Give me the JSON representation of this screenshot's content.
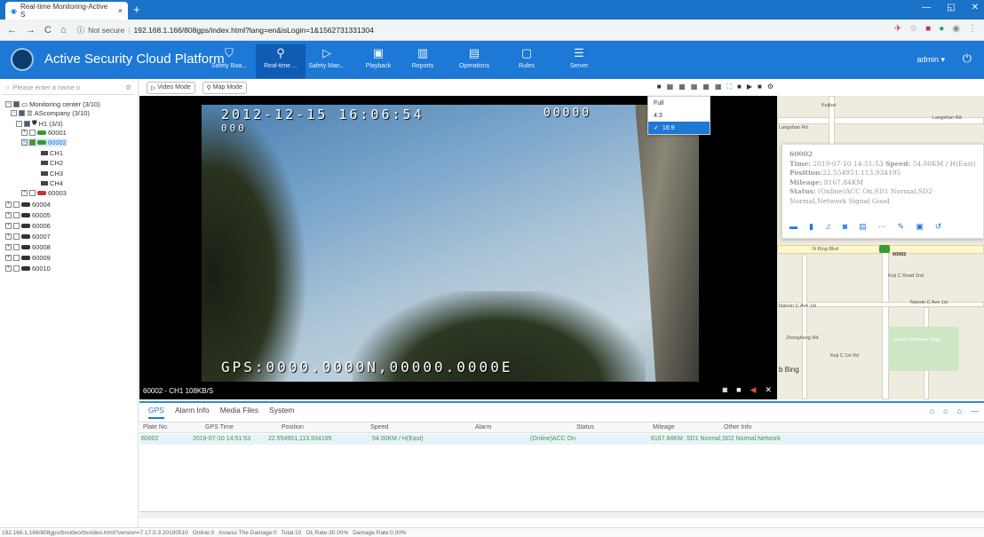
{
  "browser": {
    "tab_title": "Real-time Monitoring-Active S",
    "security_label": "Not secure",
    "url": "192.168.1.166/808gps/index.html?lang=en&isLogin=1&1562731331304"
  },
  "app": {
    "title": "Active Security Cloud Platform",
    "nav": [
      {
        "label": "Safety Boa...",
        "icon": "shield-icon"
      },
      {
        "label": "Real-time ...",
        "icon": "location-pin-icon"
      },
      {
        "label": "Safety Man...",
        "icon": "play-shield-icon"
      },
      {
        "label": "Playback",
        "icon": "playback-icon"
      },
      {
        "label": "Reports",
        "icon": "bar-chart-icon"
      },
      {
        "label": "Operations",
        "icon": "operations-icon"
      },
      {
        "label": "Rules",
        "icon": "rules-icon"
      },
      {
        "label": "Server",
        "icon": "server-icon"
      }
    ],
    "user": "admin"
  },
  "sidebar": {
    "search_placeholder": "Please enter a name o",
    "tree": [
      {
        "label": "Monitoring center (3/10)"
      },
      {
        "label": "AScompany (3/10)"
      },
      {
        "label": "H1 (3/3)"
      },
      {
        "label": "60001"
      },
      {
        "label": "60002"
      },
      {
        "label": "CH1"
      },
      {
        "label": "CH2"
      },
      {
        "label": "CH3"
      },
      {
        "label": "CH4"
      },
      {
        "label": "60003"
      },
      {
        "label": "60004"
      },
      {
        "label": "60005"
      },
      {
        "label": "60006"
      },
      {
        "label": "60007"
      },
      {
        "label": "60008"
      },
      {
        "label": "60009"
      },
      {
        "label": "60010"
      }
    ]
  },
  "modes": {
    "video": "Video Mode",
    "map": "Map Mode"
  },
  "ratio_menu": {
    "options": [
      "Full",
      "4:3",
      "16:9"
    ],
    "selected": "16:9"
  },
  "video": {
    "timestamp": "2012-12-15 16:06:54",
    "counter": "00000",
    "zeros": "000",
    "gps": "GPS:0000.0000N,00000.0000E",
    "footer": "60002 - CH1 108KB/S"
  },
  "map": {
    "labels": [
      "Langshan Rd",
      "Kejibei",
      "N Ring Blvd",
      "Nanxin C Ave 1st",
      "Keji C Road 2nd",
      "Zhonghang Rd",
      "Keji C 1st Rd",
      "Gaoxin Software Bldg",
      "Bing"
    ],
    "vehicle_label": "60002"
  },
  "infobox": {
    "title": "60002",
    "time_label": "Time:",
    "time": "2019-07-10 14:51:53",
    "speed_label": "Speed:",
    "speed": "54.00KM / H(East)",
    "position_label": "Position:",
    "position": "22.554951,113.934195",
    "mileage_label": "Mileage:",
    "mileage": "8167.84KM",
    "status_label": "Status:",
    "status": "(Online)ACC On,SD1 Normal,SD2 Normal,Network Signal Good"
  },
  "bottom": {
    "tabs": [
      "GPS",
      "Alarm Info",
      "Media Files",
      "System"
    ],
    "columns": [
      "Plate No.",
      "GPS Time",
      "Position",
      "Speed",
      "Alarm",
      "Status",
      "Mileage",
      "Other Info"
    ],
    "rows": [
      [
        "60002",
        "2019-07-10 14:51:53",
        "22.554951,113.934195",
        "54.00KM / H(East)",
        "",
        "(Online)ACC On",
        "8167.84KM",
        "SD1 Normal,SD2 Normal,Network"
      ]
    ]
  },
  "statusbar": {
    "url": "192.168.1.166/808gps/ttxvideo/ttxvideo.html?version=7.17.0.3 20190510",
    "online": "Online:3",
    "damage": "Assess The Damage:0",
    "total": "Total:10",
    "ol_rate": "OL Rate:30.00%",
    "damage_rate": "Damage Rate:0.00%"
  }
}
